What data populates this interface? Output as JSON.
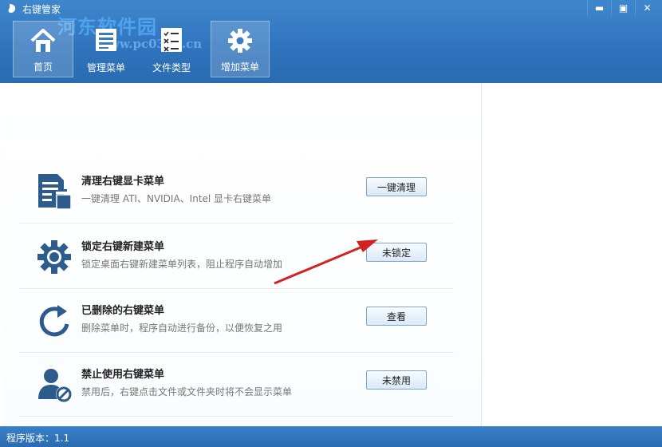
{
  "app": {
    "title": "右键管家"
  },
  "window_controls": {
    "minimize": "▬",
    "restore": "▣",
    "close": "✕"
  },
  "watermark": {
    "text": "河东软件园",
    "url": "www.pc0359.cn"
  },
  "toolbar": {
    "items": [
      {
        "label": "首页",
        "icon": "home-icon",
        "active": true
      },
      {
        "label": "管理菜单",
        "icon": "menu-list-icon",
        "active": false
      },
      {
        "label": "文件类型",
        "icon": "checklist-icon",
        "active": false
      },
      {
        "label": "增加菜单",
        "icon": "gear-icon",
        "active": true
      }
    ]
  },
  "items": [
    {
      "title": "清理右键显卡菜单",
      "desc": "一键清理 ATI、NVIDIA、Intel 显卡右键菜单",
      "button": "一键清理",
      "icon": "clean-document-icon"
    },
    {
      "title": "锁定右键新建菜单",
      "desc": "锁定桌面右键新建菜单列表，阻止程序自动增加",
      "button": "未锁定",
      "icon": "gear-icon"
    },
    {
      "title": "已删除的右键菜单",
      "desc": "删除菜单时，程序自动进行备份，以便恢复之用",
      "button": "查看",
      "icon": "refresh-icon"
    },
    {
      "title": "禁止使用右键菜单",
      "desc": "禁用后，右键点击文件或文件夹时将不会显示菜单",
      "button": "未禁用",
      "icon": "user-block-icon"
    }
  ],
  "status": {
    "version": "程序版本：1.1"
  },
  "colors": {
    "header": "#2f73bc",
    "icon": "#2d5c8c",
    "arrow": "#d42020"
  }
}
